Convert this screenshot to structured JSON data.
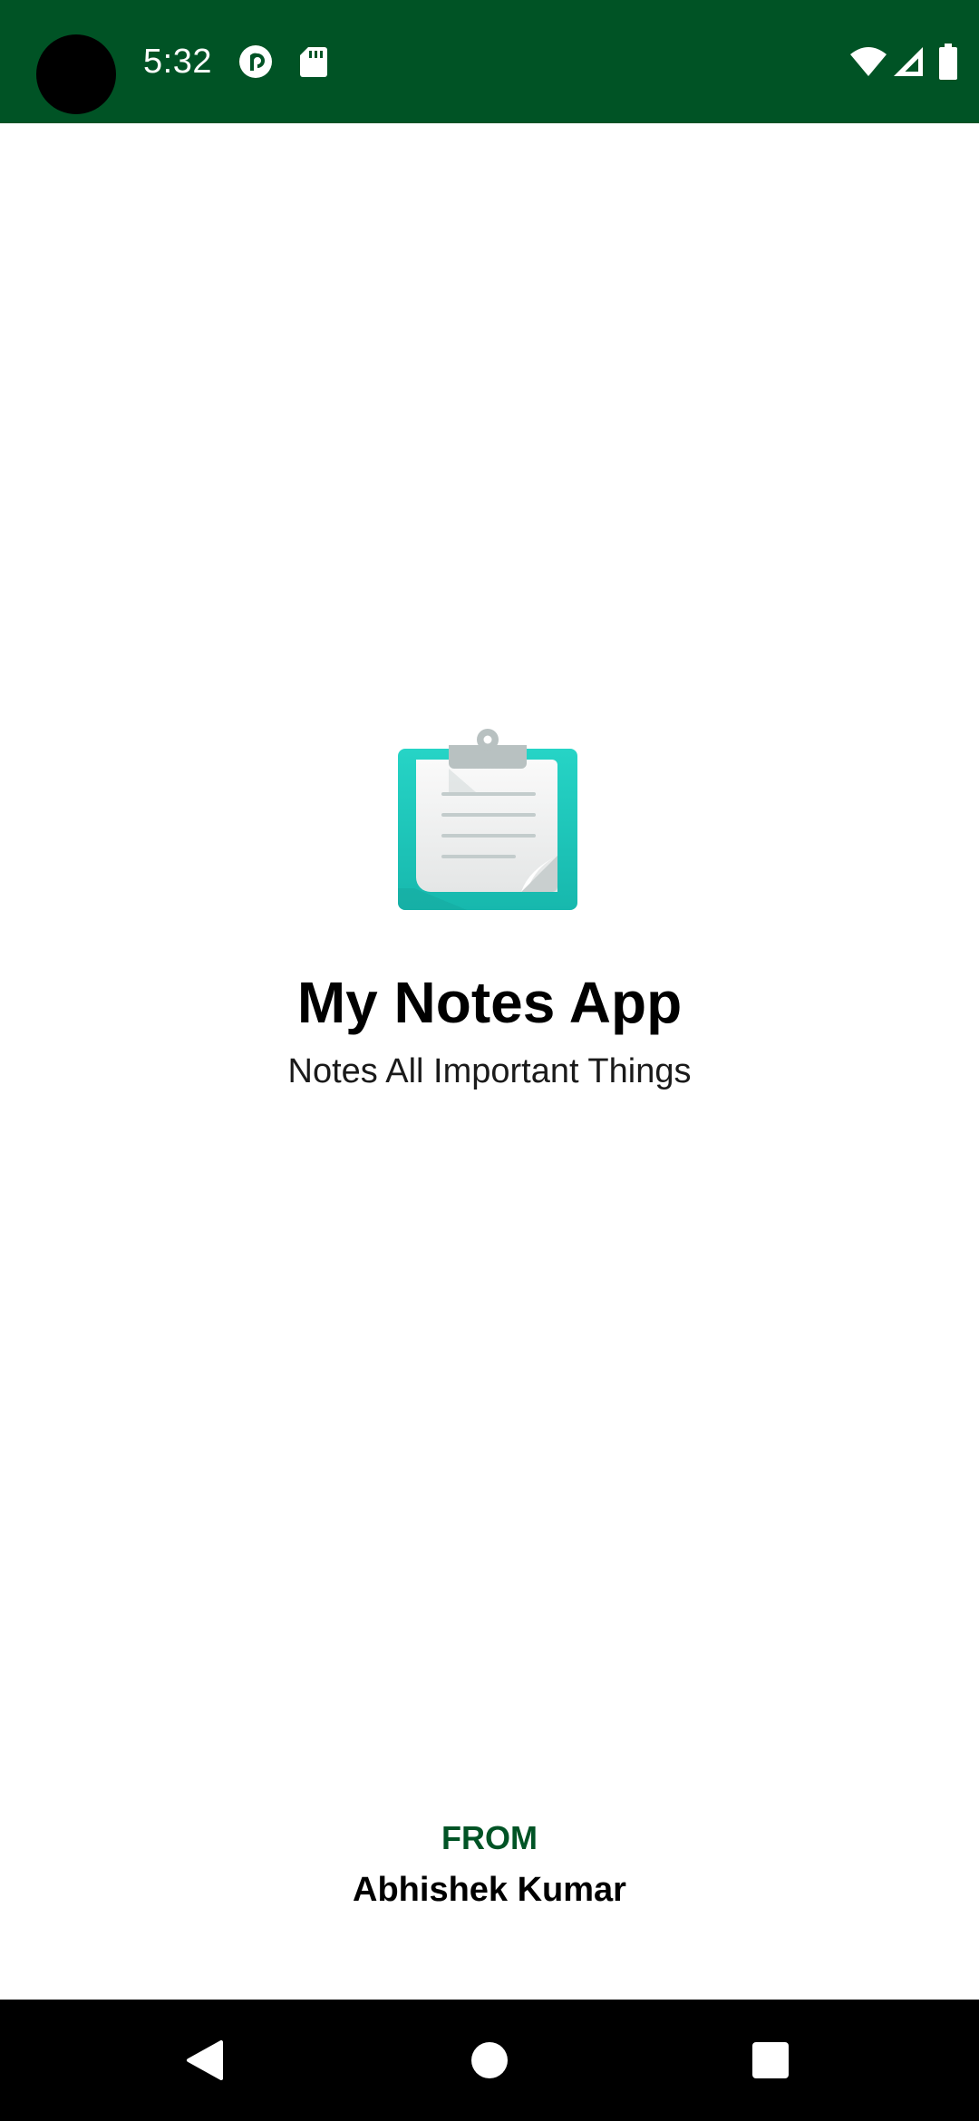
{
  "status_bar": {
    "time": "5:32",
    "background_color": "#005325",
    "left_icons": [
      "pocket-casts-icon",
      "sd-card-icon"
    ],
    "right_icons": [
      "wifi-icon",
      "cell-signal-icon",
      "battery-icon"
    ]
  },
  "splash": {
    "logo_icon": "clipboard-notes-icon",
    "title": "My Notes App",
    "tagline": "Notes All Important Things",
    "from_label": "FROM",
    "author": "Abhishek Kumar",
    "accent_color": "#005325",
    "logo_color": "#1ecbbe"
  },
  "nav_bar": {
    "buttons": [
      "back-icon",
      "home-icon",
      "recents-icon"
    ]
  }
}
